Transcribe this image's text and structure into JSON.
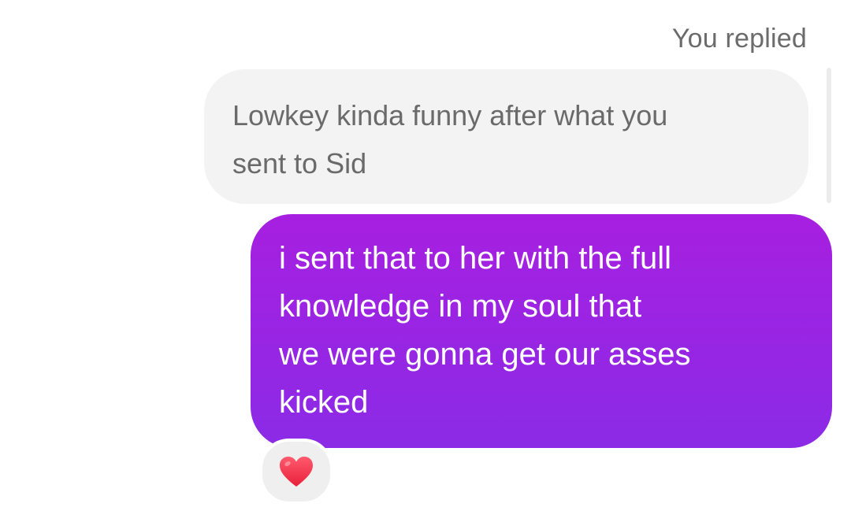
{
  "reply_context": {
    "label": "You replied"
  },
  "quoted_message": {
    "lines": [
      "Lowkey kinda funny after what you",
      "sent to Sid"
    ]
  },
  "message": {
    "lines": [
      "i sent that to her with the full",
      "knowledge in my soul that",
      "we were gonna get our asses",
      "kicked"
    ]
  },
  "reaction": {
    "icon": "red-heart-icon",
    "color": "#f0324a"
  },
  "colors": {
    "bubble_gradient_top": "#a71fe0",
    "bubble_gradient_bottom": "#8b2be6",
    "quoted_bg": "#f3f3f3"
  }
}
